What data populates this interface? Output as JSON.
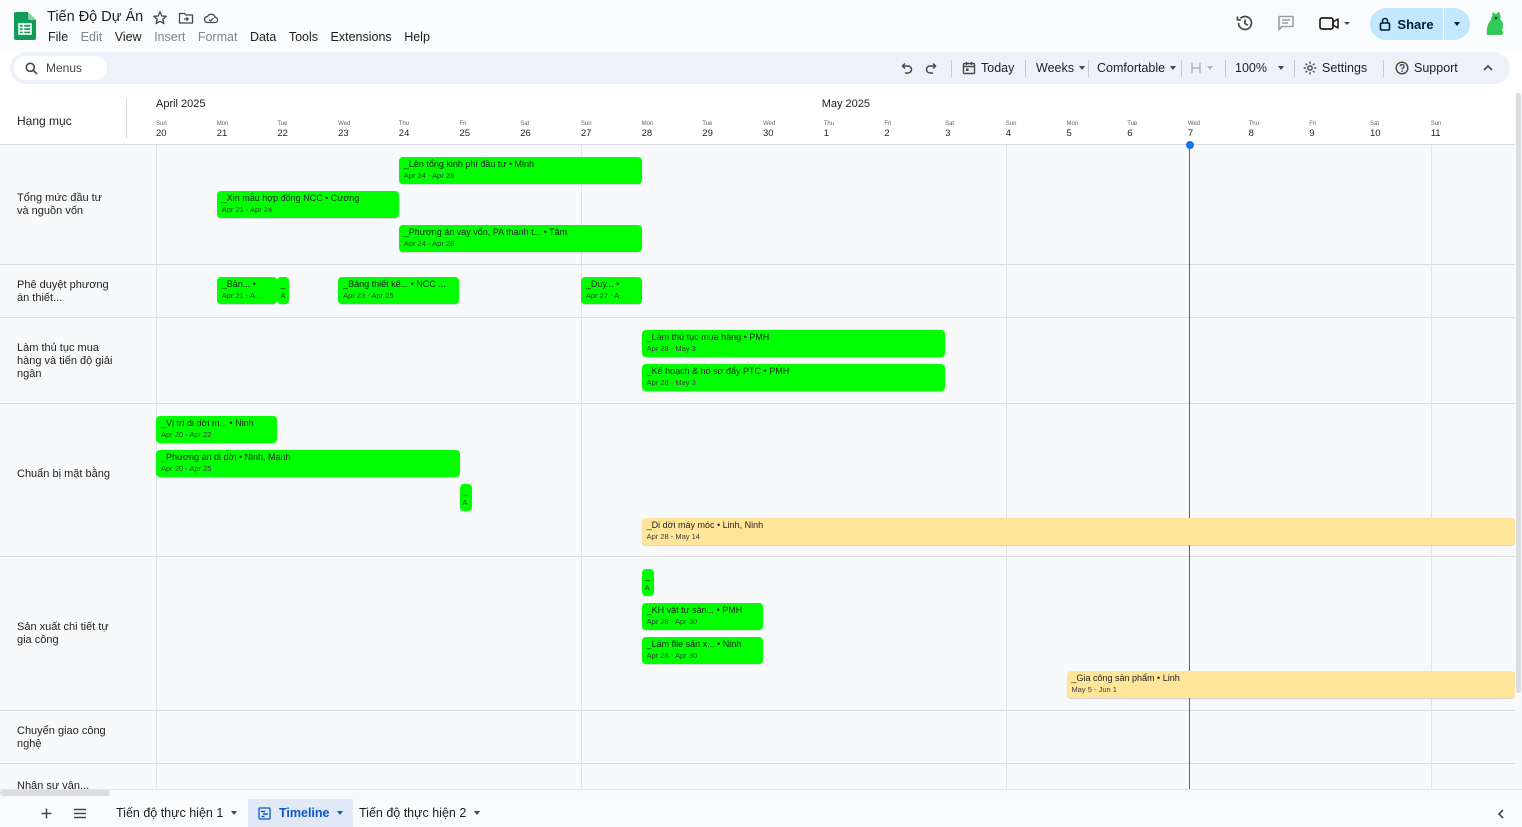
{
  "app": {
    "doc_title": "Tiến Độ Dự Án",
    "menu": [
      "File",
      "Edit",
      "View",
      "Insert",
      "Format",
      "Data",
      "Tools",
      "Extensions",
      "Help"
    ],
    "menu_disabled": [
      false,
      true,
      false,
      true,
      true,
      false,
      false,
      false,
      false
    ],
    "share_label": "Share",
    "brand_color": "#0f9d58",
    "accent_color": "#c2e7ff"
  },
  "toolbar": {
    "search_label": "Menus",
    "today_label": "Today",
    "weeks_label": "Weeks",
    "density_label": "Comfortable",
    "zoom_label": "100%",
    "settings_label": "Settings",
    "support_label": "Support"
  },
  "timeline": {
    "category_header": "Hạng mục",
    "months": [
      "April 2025",
      "May 2025"
    ],
    "days": [
      {
        "dow": "Sun",
        "num": "20"
      },
      {
        "dow": "Mon",
        "num": "21"
      },
      {
        "dow": "Tue",
        "num": "22"
      },
      {
        "dow": "Wed",
        "num": "23"
      },
      {
        "dow": "Thu",
        "num": "24"
      },
      {
        "dow": "Fri",
        "num": "25"
      },
      {
        "dow": "Sat",
        "num": "26"
      },
      {
        "dow": "Sun",
        "num": "27"
      },
      {
        "dow": "Mon",
        "num": "28"
      },
      {
        "dow": "Tue",
        "num": "29"
      },
      {
        "dow": "Wed",
        "num": "30"
      },
      {
        "dow": "Thu",
        "num": "1"
      },
      {
        "dow": "Fri",
        "num": "2"
      },
      {
        "dow": "Sat",
        "num": "3"
      },
      {
        "dow": "Sun",
        "num": "4"
      },
      {
        "dow": "Mon",
        "num": "5"
      },
      {
        "dow": "Tue",
        "num": "6"
      },
      {
        "dow": "Wed",
        "num": "7"
      },
      {
        "dow": "Thu",
        "num": "8"
      },
      {
        "dow": "Fri",
        "num": "9"
      },
      {
        "dow": "Sat",
        "num": "10"
      },
      {
        "dow": "Sun",
        "num": "11"
      }
    ],
    "today_index": 17,
    "rows": [
      {
        "label": "Tổng mức đầu tư và nguồn vốn"
      },
      {
        "label": "Phê duyệt phương án thiết..."
      },
      {
        "label": "Làm thủ tục mua hàng và tiến độ giải ngân"
      },
      {
        "label": "Chuẩn bị mặt bằng"
      },
      {
        "label": "Sản xuất chi tiết tự gia công"
      },
      {
        "label": "Chuyển giao công nghệ"
      },
      {
        "label": "Nhân sự vận..."
      }
    ],
    "tasks": [
      {
        "row": 0,
        "lane": 0,
        "start": 4,
        "span": 4,
        "title": "_Lên tổng kinh phí đầu tư • Minh",
        "dates": "Apr 24 - Apr 28",
        "color": "green"
      },
      {
        "row": 0,
        "lane": 1,
        "start": 1,
        "span": 3,
        "title": "_Xin mẫu hợp đồng NCC • Cương",
        "dates": "Apr 21 - Apr 24",
        "color": "green"
      },
      {
        "row": 0,
        "lane": 2,
        "start": 4,
        "span": 4,
        "title": "_Phương án vay vốn, PA thanh t... • Tâm",
        "dates": "Apr 24 - Apr 28",
        "color": "green"
      },
      {
        "row": 1,
        "lane": 0,
        "start": 1,
        "span": 1,
        "title": "_Bản... •",
        "dates": "Apr 21 - A...",
        "color": "green"
      },
      {
        "row": 1,
        "lane": 0,
        "start": 2,
        "span": 0.2,
        "title": "_",
        "dates": "A",
        "color": "green"
      },
      {
        "row": 1,
        "lane": 0,
        "start": 3,
        "span": 2,
        "title": "_Bảng thiết kế... • NCC ...",
        "dates": "Apr 23 - Apr 25",
        "color": "green"
      },
      {
        "row": 1,
        "lane": 0,
        "start": 7,
        "span": 1,
        "title": "_Duy... •",
        "dates": "Apr 27 - A...",
        "color": "green"
      },
      {
        "row": 2,
        "lane": 0,
        "start": 8,
        "span": 5,
        "title": "_Làm thủ tục mua hàng • PMH",
        "dates": "Apr 28 - May 3",
        "color": "green"
      },
      {
        "row": 2,
        "lane": 1,
        "start": 8,
        "span": 5,
        "title": "_Kế hoạch & hồ sơ đẩy PTC  • PMH",
        "dates": "Apr 28 - May 3",
        "color": "green"
      },
      {
        "row": 3,
        "lane": 0,
        "start": 0,
        "span": 2,
        "title": "_Vị trí di dời m... • Ninh",
        "dates": "Apr 20 - Apr 22",
        "color": "green"
      },
      {
        "row": 3,
        "lane": 1,
        "start": 0,
        "span": 5,
        "title": "_Phương án di dời • Ninh, Mạnh",
        "dates": "Apr 20 - Apr 25",
        "color": "green"
      },
      {
        "row": 3,
        "lane": 2,
        "start": 5,
        "span": 0.2,
        "title": "_",
        "dates": "A",
        "color": "green"
      },
      {
        "row": 3,
        "lane": 3,
        "start": 8,
        "span": 16,
        "title": "_Di dời máy móc • Linh, Ninh",
        "dates": "Apr 28 - May 14",
        "color": "yellow"
      },
      {
        "row": 4,
        "lane": 0,
        "start": 8,
        "span": 0.2,
        "title": "_",
        "dates": "A",
        "color": "green"
      },
      {
        "row": 4,
        "lane": 1,
        "start": 8,
        "span": 2,
        "title": "_KH vật tư sản... • PMH",
        "dates": "Apr 28 - Apr 30",
        "color": "green"
      },
      {
        "row": 4,
        "lane": 2,
        "start": 8,
        "span": 2,
        "title": "_Làm file sản x... • Ninh",
        "dates": "Apr 28 - Apr 30",
        "color": "green"
      },
      {
        "row": 4,
        "lane": 3,
        "start": 15,
        "span": 27,
        "title": "_Gia công sản phẩm • Linh",
        "dates": "May 5 - Jun 1",
        "color": "yellow"
      }
    ]
  },
  "sheets": {
    "tabs": [
      "Tiến độ thực hiện 1",
      "Timeline",
      "Tiến độ thực hiện 2"
    ],
    "active_index": 1
  }
}
